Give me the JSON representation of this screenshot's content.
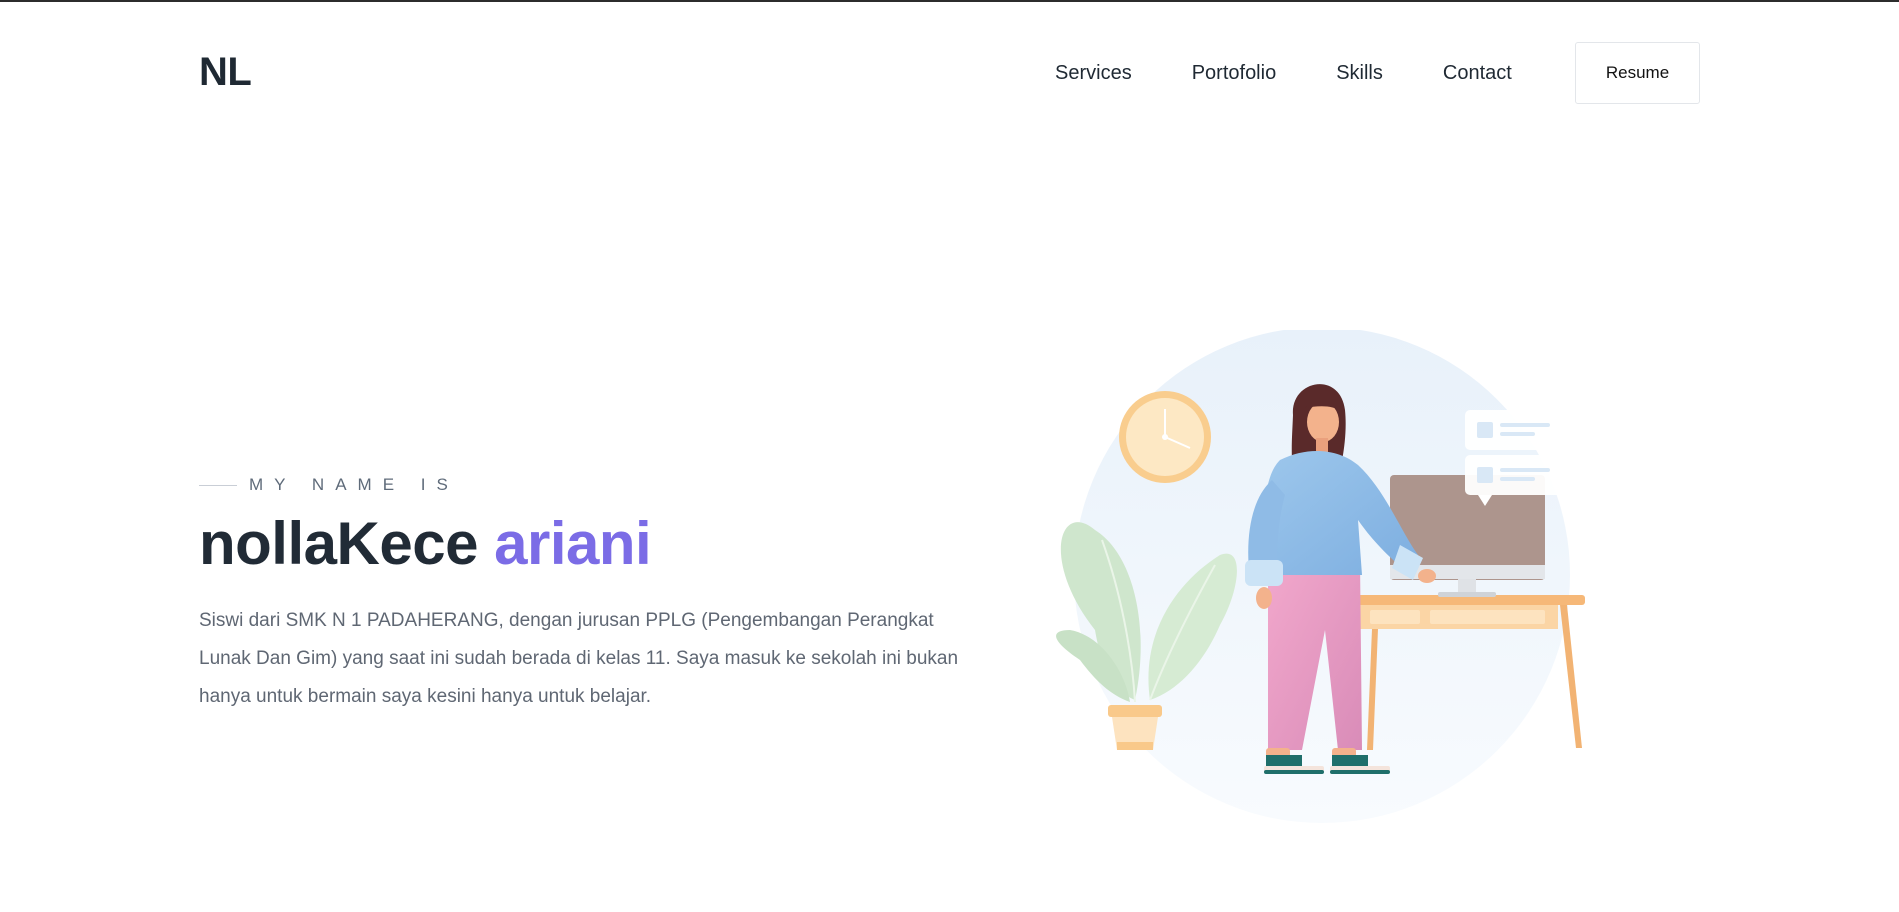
{
  "header": {
    "logo": "NL",
    "nav": [
      "Services",
      "Portofolio",
      "Skills",
      "Contact"
    ],
    "resume_label": "Resume"
  },
  "hero": {
    "eyebrow": "MY NAME IS",
    "name_first": "nollaKece",
    "name_accent": "ariani",
    "bio": "Siswi dari SMK N 1 PADAHERANG, dengan jurusan PPLG (Pengembangan Perangkat Lunak Dan Gim) yang saat ini sudah berada di kelas 11. Saya masuk ke sekolah ini bukan hanya untuk bermain saya kesini hanya untuk belajar."
  },
  "colors": {
    "accent": "#7b6ce6",
    "text": "#212b36",
    "muted": "#5f6773"
  }
}
